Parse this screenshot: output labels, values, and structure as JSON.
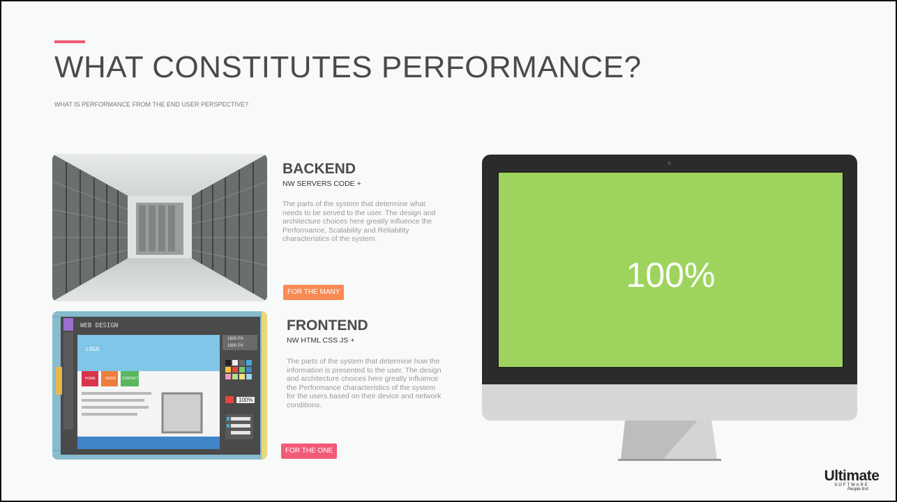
{
  "slide": {
    "title": "WHAT CONSTITUTES PERFORMANCE?",
    "subtitle": "WHAT IS PERFORMANCE FROM THE END USER PERSPECTIVE?"
  },
  "colors": {
    "accent": "#ef5a6f",
    "orange": "#f98a52",
    "pink": "#f25b78",
    "screen_green": "#9ed45d"
  },
  "backend": {
    "title": "BACKEND",
    "subtitle": "NW SERVERS CODE +",
    "description": "The parts of the system that determine what needs to be served to the user. The design and architecture choices here greatly influence the  Performance, Scalability and Reliability characteristics of the system.",
    "button_label": "FOR THE MANY"
  },
  "frontend": {
    "title": "FRONTEND",
    "subtitle": "NW HTML CSS JS +",
    "description": "The parts of the system that determine how the information is presented to the user. The design and architecture choices here greatly influence the Performance characteristics of the system for the users based on their device and network conditions.",
    "button_label": "FOR THE ONE"
  },
  "web_design_image": {
    "window_title": "WEB DESIGN",
    "logo_text": "LOGO",
    "nav_home": "HOME",
    "nav_news": "NEWS",
    "nav_contact": "CONTACT",
    "size_w": "1600 PX",
    "size_h": "1600 PX",
    "zoom": "100%"
  },
  "monitor": {
    "screen_value": "100%"
  },
  "logo": {
    "name": "Ultimate",
    "sub": "SOFTWARE",
    "tagline": "People first"
  }
}
